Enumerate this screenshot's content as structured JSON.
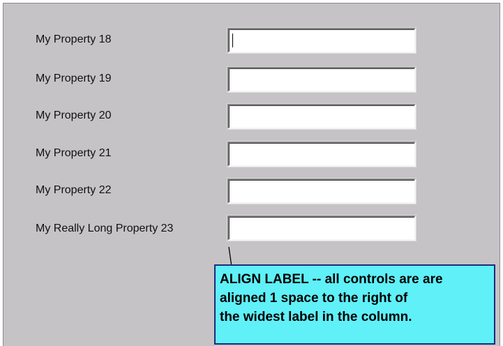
{
  "form": {
    "rows": [
      {
        "label": "My Property 18",
        "value": ""
      },
      {
        "label": "My Property 19",
        "value": ""
      },
      {
        "label": "My Property 20",
        "value": ""
      },
      {
        "label": "My Property 21",
        "value": ""
      },
      {
        "label": "My Property 22",
        "value": ""
      },
      {
        "label": "My Really Long Property 23",
        "value": ""
      }
    ]
  },
  "callout": {
    "lines": [
      "ALIGN LABEL -- all controls are are",
      "aligned 1 space to the right of",
      "the widest label in the column."
    ],
    "background_color": "#5ff0f8",
    "border_color": "#1d2b7a"
  },
  "colors": {
    "panel": "#c6c3c6"
  }
}
